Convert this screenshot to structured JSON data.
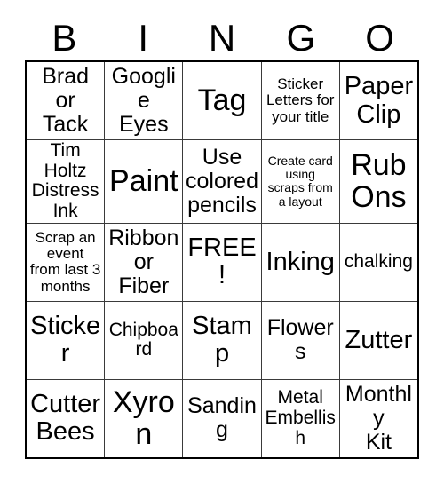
{
  "card": {
    "header_letters": [
      "B",
      "I",
      "N",
      "G",
      "O"
    ],
    "free_space_label": "FREE!",
    "colors": {
      "background": "#ffffff",
      "text": "#000000",
      "grid_line": "#3a3a3a",
      "outer_border": "#000000"
    },
    "rows": [
      [
        {
          "text": "Brad\nor\nTack",
          "size": "lg"
        },
        {
          "text": "Googlie\nEyes",
          "size": "lg"
        },
        {
          "text": "Tag",
          "size": "xxl"
        },
        {
          "text": "Sticker\nLetters for\nyour title",
          "size": "sm"
        },
        {
          "text": "Paper\nClip",
          "size": "xl"
        }
      ],
      [
        {
          "text": "Tim Holtz\nDistress\nInk",
          "size": "md"
        },
        {
          "text": "Paint",
          "size": "xxl"
        },
        {
          "text": "Use\ncolored\npencils",
          "size": "lg"
        },
        {
          "text": "Create card\nusing\nscraps from\na layout",
          "size": "xs"
        },
        {
          "text": "Rub\nOns",
          "size": "xxl"
        }
      ],
      [
        {
          "text": "Scrap an\nevent\nfrom last 3\nmonths",
          "size": "sm"
        },
        {
          "text": "Ribbon\nor\nFiber",
          "size": "lg"
        },
        {
          "text": "FREE!",
          "size": "xl"
        },
        {
          "text": "Inking",
          "size": "xl"
        },
        {
          "text": "chalking",
          "size": "md"
        }
      ],
      [
        {
          "text": "Sticker",
          "size": "xl"
        },
        {
          "text": "Chipboard",
          "size": "md"
        },
        {
          "text": "Stamp",
          "size": "xl"
        },
        {
          "text": "Flowers",
          "size": "lg"
        },
        {
          "text": "Zutter",
          "size": "xl"
        }
      ],
      [
        {
          "text": "Cutter\nBees",
          "size": "xl"
        },
        {
          "text": "Xyron",
          "size": "xxl"
        },
        {
          "text": "Sanding",
          "size": "lg"
        },
        {
          "text": "Metal\nEmbellish",
          "size": "md"
        },
        {
          "text": "Monthly\nKit",
          "size": "lg"
        }
      ]
    ]
  }
}
